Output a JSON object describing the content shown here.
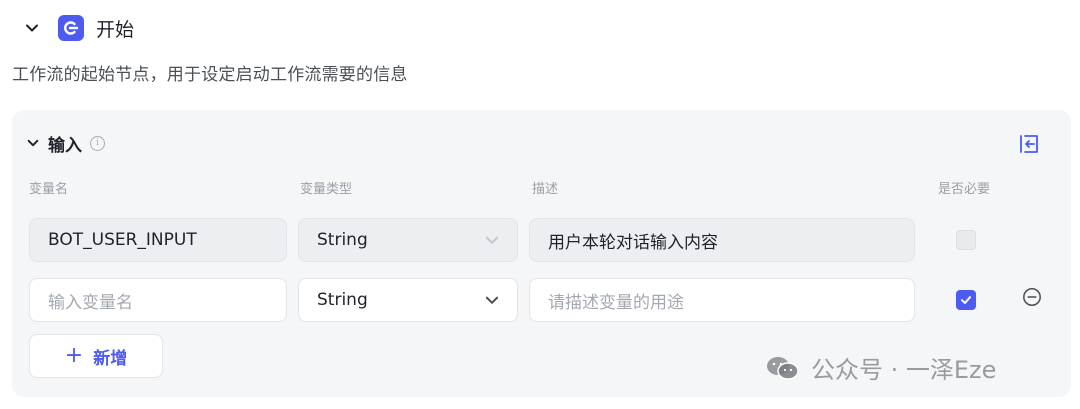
{
  "node": {
    "title": "开始",
    "description": "工作流的起始节点，用于设定启动工作流需要的信息"
  },
  "input_section": {
    "title": "输入",
    "info_symbol": "i",
    "columns": {
      "name": "变量名",
      "type": "变量类型",
      "desc": "描述",
      "required": "是否必要"
    },
    "rows": [
      {
        "name": "BOT_USER_INPUT",
        "type": "String",
        "description": "用户本轮对话输入内容",
        "required": false,
        "disabled": true
      },
      {
        "name_placeholder": "输入变量名",
        "type": "String",
        "description_placeholder": "请描述变量的用途",
        "required": true,
        "disabled": false
      }
    ],
    "add_button": {
      "icon": "+",
      "label": "新增"
    }
  },
  "watermark": "公众号 · 一泽Eze",
  "colors": {
    "accent": "#4e5bf2",
    "panel_bg": "#f5f6f8",
    "muted_text": "#9aa0a8"
  },
  "icons": [
    "chevron-down-icon",
    "node-start-icon",
    "info-icon",
    "export-icon",
    "dropdown-arrow-icon",
    "check-icon",
    "remove-circle-icon",
    "wechat-icon"
  ]
}
